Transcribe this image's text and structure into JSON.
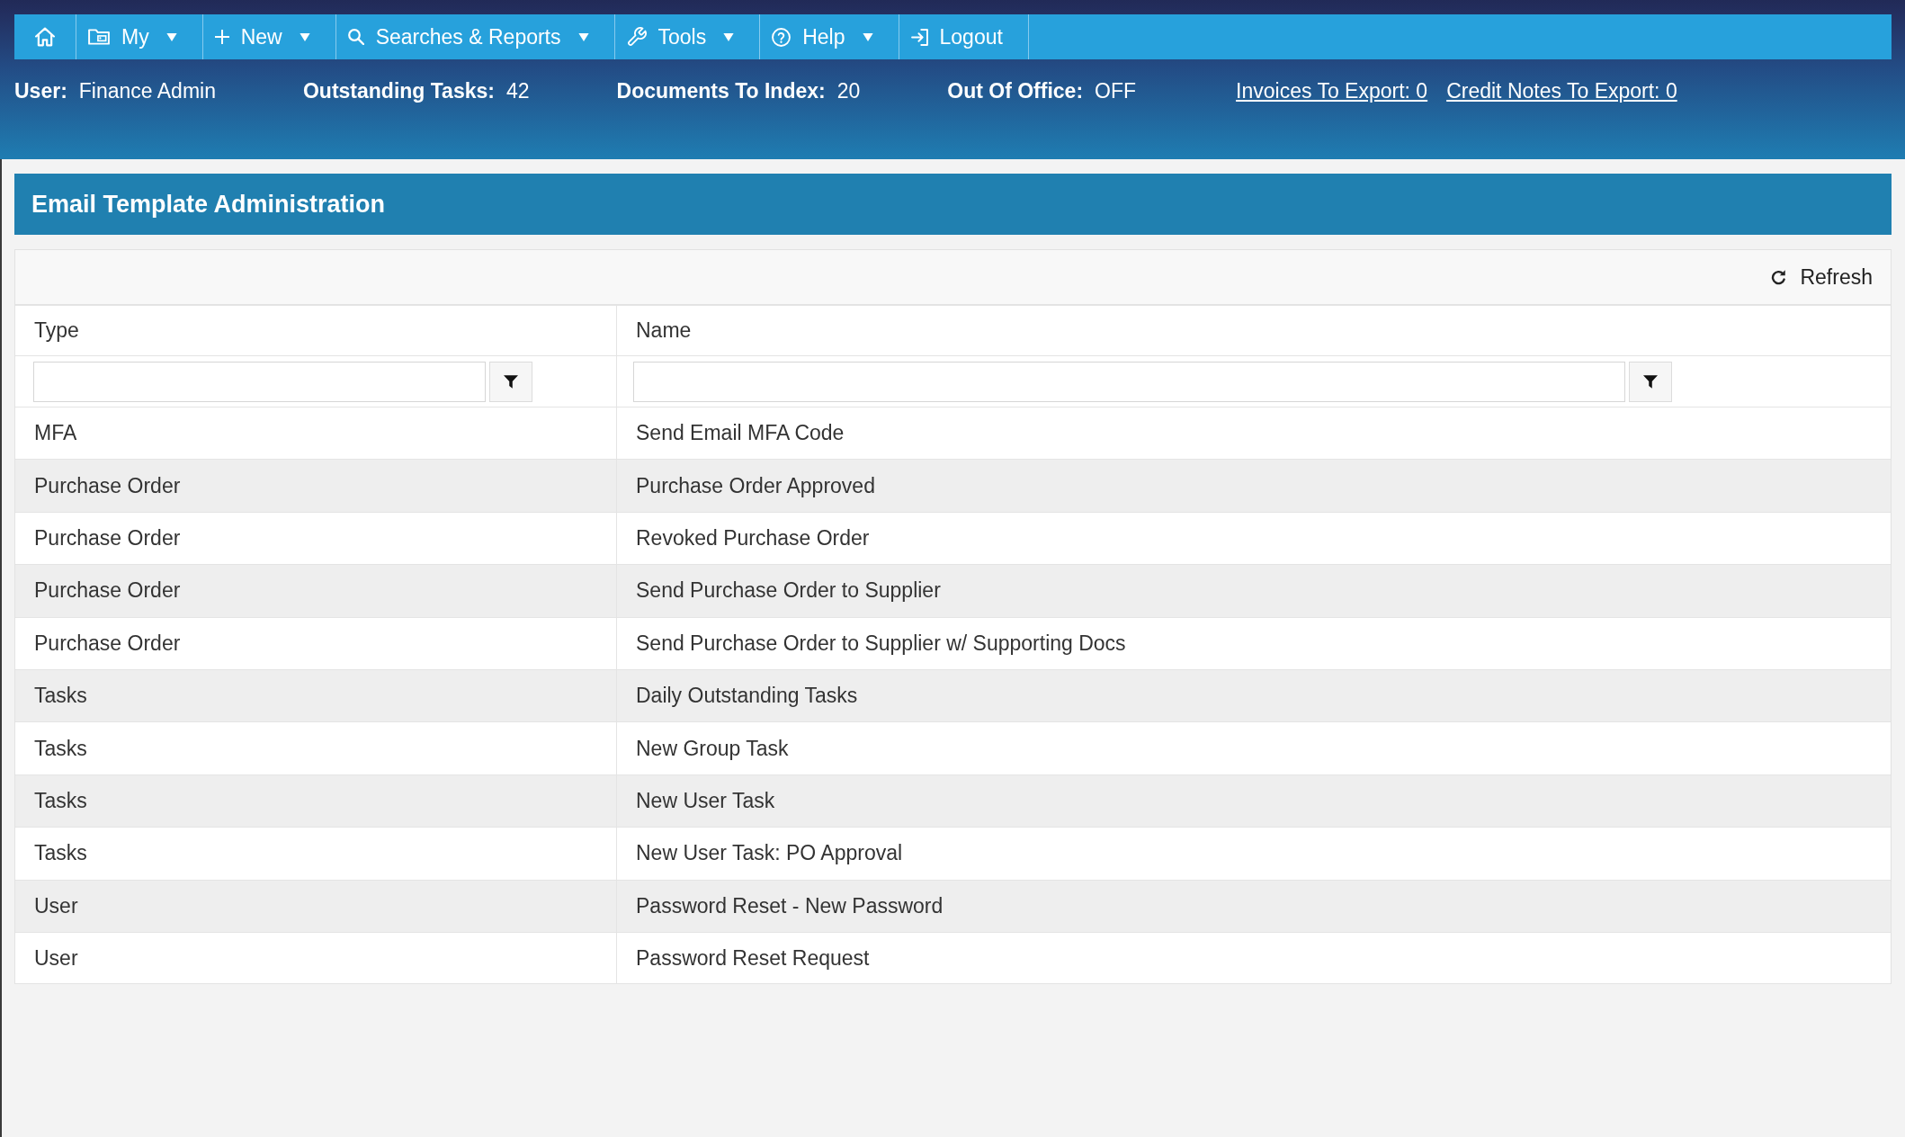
{
  "nav": {
    "items": [
      {
        "label": "My",
        "dropdown": true
      },
      {
        "label": "New",
        "dropdown": true
      },
      {
        "label": "Searches & Reports",
        "dropdown": true
      },
      {
        "label": "Tools",
        "dropdown": true
      },
      {
        "label": "Help",
        "dropdown": true
      },
      {
        "label": "Logout",
        "dropdown": false
      }
    ]
  },
  "info_bar": {
    "fields": [
      {
        "label": "User:",
        "value": "Finance Admin"
      },
      {
        "label": "Outstanding Tasks:",
        "value": "42"
      },
      {
        "label": "Documents To Index:",
        "value": "20"
      },
      {
        "label": "Out Of Office:",
        "value": "OFF"
      }
    ],
    "links": [
      "Invoices To Export: 0",
      "Credit Notes To Export: 0"
    ]
  },
  "panel": {
    "title": "Email Template Administration",
    "toolbar": {
      "refresh_label": "Refresh"
    },
    "table": {
      "columns": [
        "Type",
        "Name"
      ],
      "rows": [
        {
          "type": "MFA",
          "name": "Send Email MFA Code"
        },
        {
          "type": "Purchase Order",
          "name": "Purchase Order Approved"
        },
        {
          "type": "Purchase Order",
          "name": "Revoked Purchase Order"
        },
        {
          "type": "Purchase Order",
          "name": "Send Purchase Order to Supplier"
        },
        {
          "type": "Purchase Order",
          "name": "Send Purchase Order to Supplier w/ Supporting Docs"
        },
        {
          "type": "Tasks",
          "name": "Daily Outstanding Tasks"
        },
        {
          "type": "Tasks",
          "name": "New Group Task"
        },
        {
          "type": "Tasks",
          "name": "New User Task"
        },
        {
          "type": "Tasks",
          "name": "New User Task: PO Approval"
        },
        {
          "type": "User",
          "name": "Password Reset - New Password"
        },
        {
          "type": "User",
          "name": "Password Reset Request"
        }
      ]
    }
  }
}
